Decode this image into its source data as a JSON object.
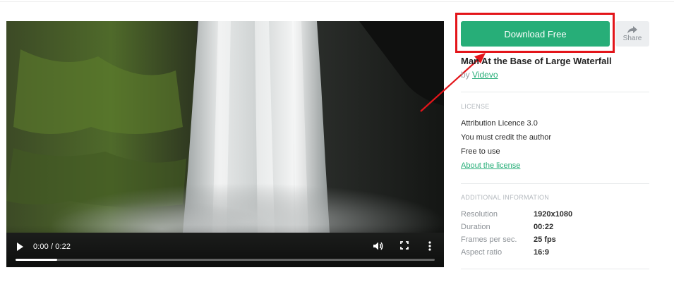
{
  "video": {
    "time_display": "0:00 / 0:22",
    "progress": 0.1,
    "controls": {
      "play_icon": "play-icon",
      "volume_icon": "volume-icon",
      "fullscreen_icon": "fullscreen-icon",
      "more_icon": "more-vertical-icon"
    }
  },
  "actions": {
    "download_label": "Download Free",
    "share_label": "Share",
    "share_icon": "share-arrow-icon",
    "accent_color": "#27ae78",
    "annotation_color": "#e3151a"
  },
  "clip": {
    "title": "Man At the Base of Large Waterfall",
    "by_prefix": "by",
    "author": "Videvo"
  },
  "license": {
    "heading": "LICENSE",
    "items": [
      "Attribution Licence 3.0",
      "You must credit the author",
      "Free to use"
    ],
    "link_label": "About the license"
  },
  "additional": {
    "heading": "ADDITIONAL INFORMATION",
    "rows": [
      {
        "key": "Resolution",
        "value": "1920x1080"
      },
      {
        "key": "Duration",
        "value": "00:22"
      },
      {
        "key": "Frames per sec.",
        "value": "25 fps"
      },
      {
        "key": "Aspect ratio",
        "value": "16:9"
      }
    ]
  }
}
